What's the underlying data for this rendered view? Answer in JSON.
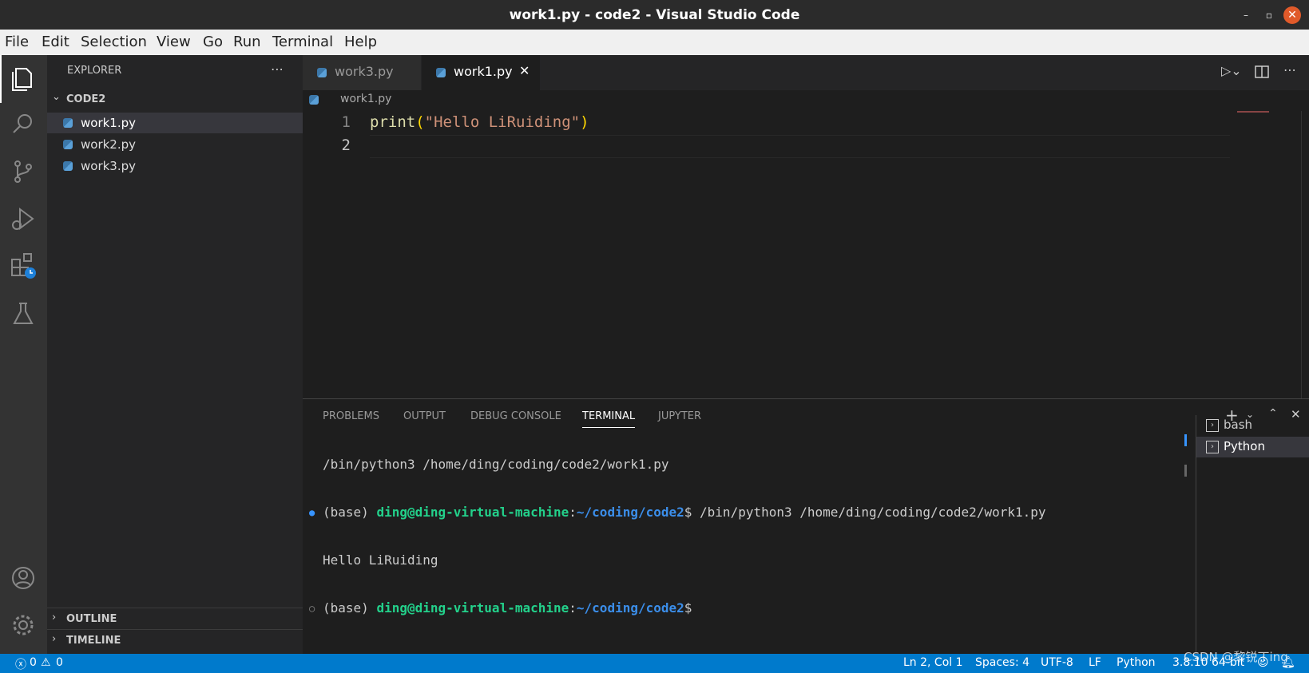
{
  "window": {
    "title": "work1.py - code2 - Visual Studio Code"
  },
  "menu": [
    "File",
    "Edit",
    "Selection",
    "View",
    "Go",
    "Run",
    "Terminal",
    "Help"
  ],
  "sidebar": {
    "title": "EXPLORER",
    "folder": "CODE2",
    "files": [
      "work1.py",
      "work2.py",
      "work3.py"
    ],
    "outline": "OUTLINE",
    "timeline": "TIMELINE"
  },
  "tabs": [
    {
      "label": "work3.py",
      "active": false
    },
    {
      "label": "work1.py",
      "active": true
    }
  ],
  "breadcrumb": "work1.py",
  "code": {
    "lines": [
      "1",
      "2"
    ],
    "fn": "print",
    "open": "(",
    "str": "\"Hello LiRuiding\"",
    "close": ")"
  },
  "panel": {
    "tabs": [
      "PROBLEMS",
      "OUTPUT",
      "DEBUG CONSOLE",
      "TERMINAL",
      "JUPYTER"
    ],
    "active_tab": "TERMINAL",
    "terminals": [
      "bash",
      "Python"
    ],
    "lines": [
      {
        "plain": "/bin/python3 /home/ding/coding/code2/work1.py"
      },
      {
        "prefix": "(base) ",
        "user": "ding@ding-virtual-machine",
        "colon": ":",
        "path": "~/coding/code2",
        "rest": "$ /bin/python3 /home/ding/coding/code2/work1.py"
      },
      {
        "plain": "Hello LiRuiding"
      },
      {
        "prefix": "(base) ",
        "user": "ding@ding-virtual-machine",
        "colon": ":",
        "path": "~/coding/code2",
        "rest": "$"
      }
    ]
  },
  "status": {
    "errors": "0",
    "warnings": "0",
    "position": "Ln 2, Col 1",
    "spaces": "Spaces: 4",
    "encoding": "UTF-8",
    "eol": "LF",
    "language": "Python",
    "interpreter": "3.8.10 64-bit"
  },
  "watermark": "CSDN @黎锐丁ing",
  "colors": {
    "accent": "#007acc",
    "string": "#ce9178",
    "function": "#dcdcaa",
    "term_user": "#23d18b",
    "term_path": "#3b8eea"
  }
}
